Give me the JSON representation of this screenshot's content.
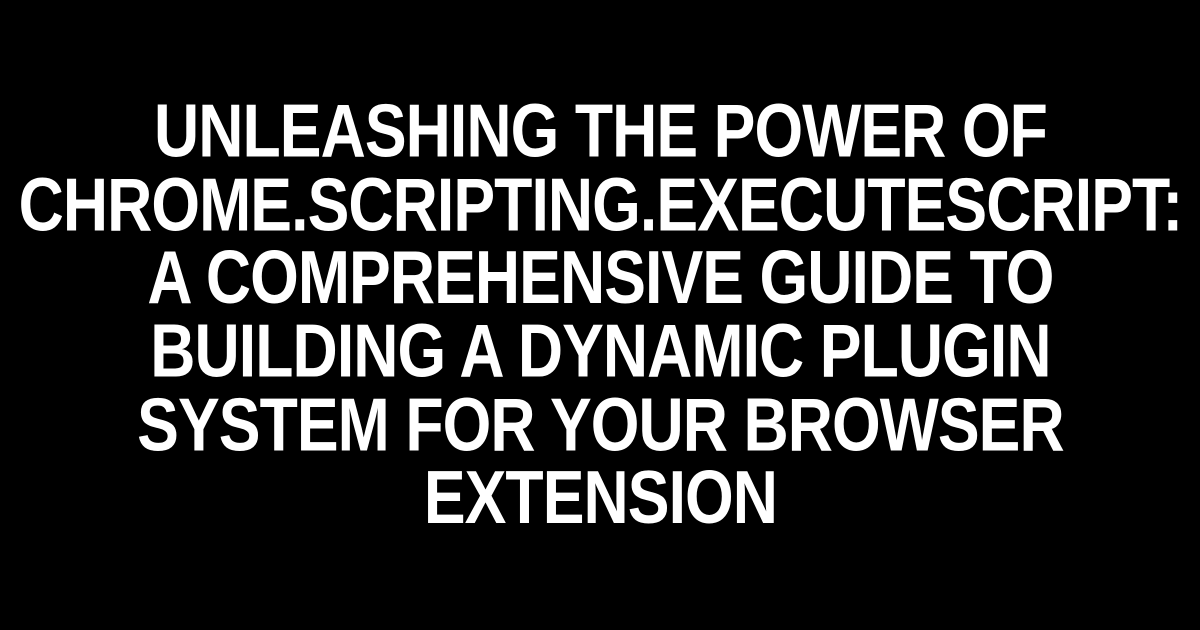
{
  "hero": {
    "title": "Unleashing the Power of chrome.scripting.executeScript: A Comprehensive Guide to Building a Dynamic Plugin System for Your Browser Extension"
  }
}
